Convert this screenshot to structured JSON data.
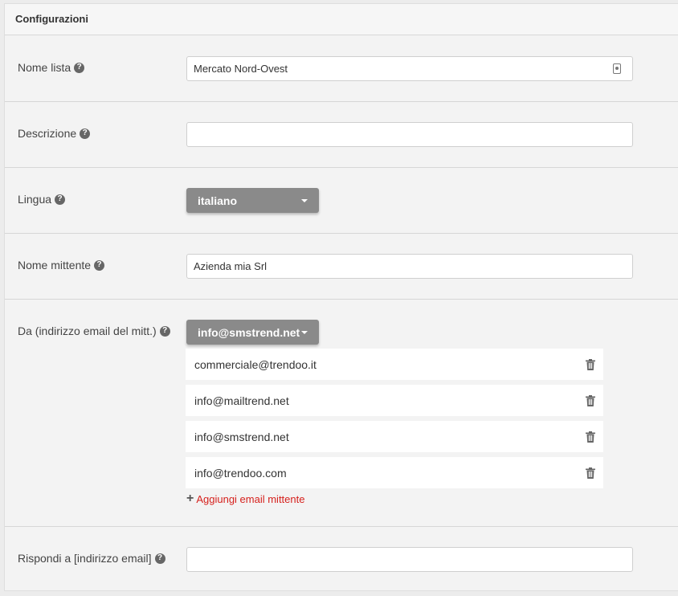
{
  "panel": {
    "title": "Configurazioni"
  },
  "fields": {
    "nome_lista": {
      "label": "Nome lista",
      "value": "Mercato Nord-Ovest"
    },
    "descrizione": {
      "label": "Descrizione",
      "value": ""
    },
    "lingua": {
      "label": "Lingua",
      "selected": "italiano"
    },
    "nome_mittente": {
      "label": "Nome mittente",
      "value": "Azienda mia Srl"
    },
    "da": {
      "label": "Da (indirizzo email del mitt.)",
      "selected": "info@smstrend.net",
      "emails": [
        "commerciale@trendoo.it",
        "info@mailtrend.net",
        "info@smstrend.net",
        "info@trendoo.com"
      ],
      "add_label": "Aggiungi email mittente"
    },
    "rispondi_a": {
      "label": "Rispondi a [indirizzo email]",
      "value": ""
    }
  },
  "icons": {
    "help": "question-circle-icon",
    "trash": "trash-icon",
    "plus": "plus-icon",
    "contact": "contact-card-icon",
    "caret": "caret-down-icon"
  },
  "colors": {
    "select_bg": "#8a8a8a",
    "add_link": "#d6211d",
    "panel_bg": "#f3f3f3"
  }
}
